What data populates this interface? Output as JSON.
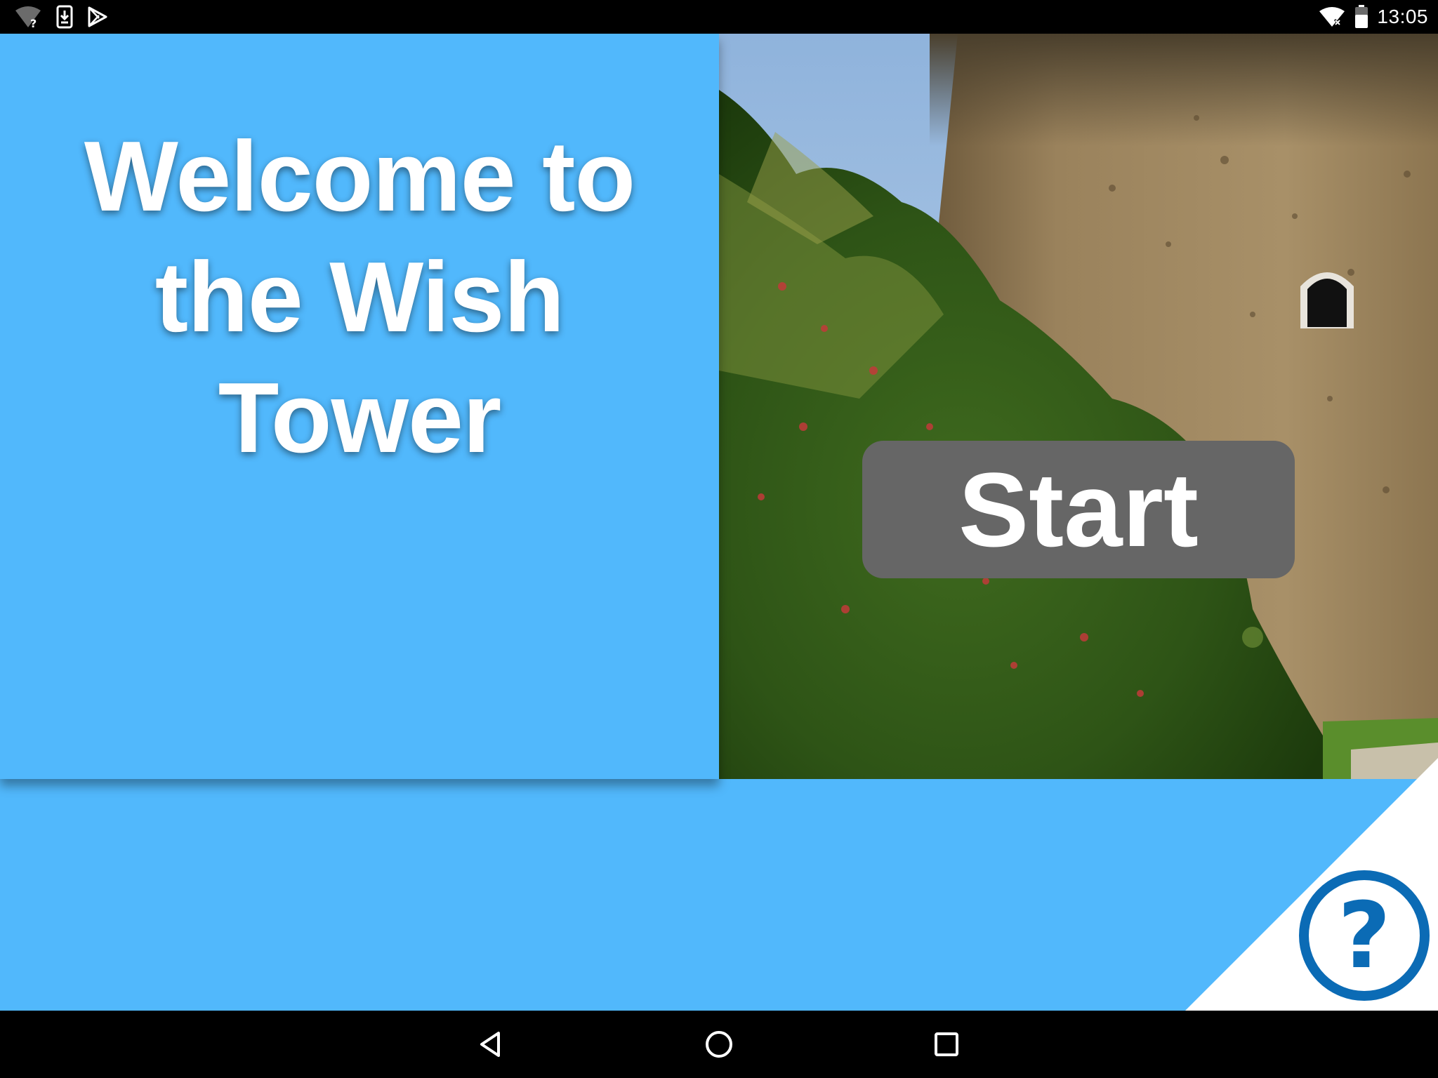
{
  "status_bar": {
    "time": "13:05",
    "left_icons": [
      "wifi-unknown-icon",
      "download-icon",
      "play-store-icon"
    ],
    "right_icons": [
      "wifi-no-data-icon",
      "battery-icon"
    ]
  },
  "welcome": {
    "title_line1": "Welcome to",
    "title_line2": "the Wish",
    "title_line3": "Tower"
  },
  "hero": {
    "image_subject": "wish-tower-photo"
  },
  "start_button": {
    "label": "Start"
  },
  "help": {
    "icon": "question-mark-icon"
  },
  "nav_bar": {
    "buttons": [
      "back-icon",
      "home-icon",
      "recents-icon"
    ]
  },
  "colors": {
    "background": "#51b8fc",
    "button_gray": "#666666",
    "help_blue": "#0b6bb5",
    "text_white": "#ffffff"
  }
}
